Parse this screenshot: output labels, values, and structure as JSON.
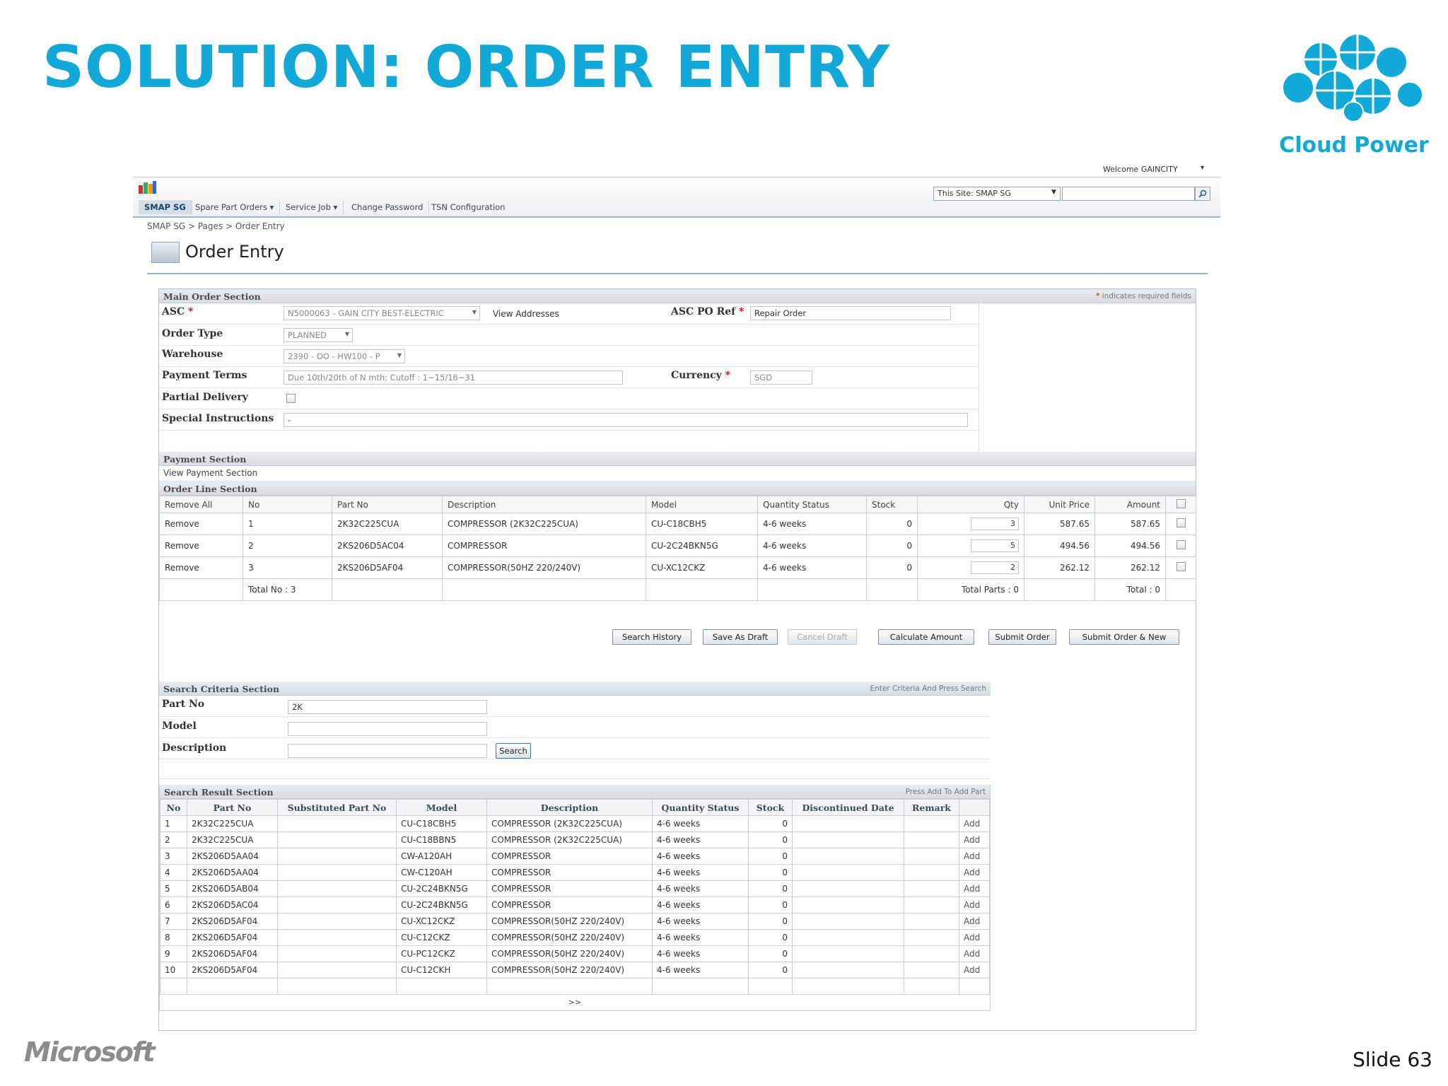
{
  "slide": {
    "title": "SOLUTION: ORDER ENTRY",
    "logo_text": "Cloud Power",
    "footer_brand": "Microsoft",
    "slide_number": "Slide 63",
    "accent_color": "#12a8d8"
  },
  "header": {
    "welcome": "Welcome GAINCITY",
    "site_select": "This Site: SMAP SG",
    "nav_tabs": [
      {
        "label": "SMAP SG",
        "active": true
      },
      {
        "label": "Spare Part Orders ▾"
      },
      {
        "label": "Service Job ▾"
      },
      {
        "label": "Change Password"
      },
      {
        "label": "TSN Configuration"
      }
    ]
  },
  "breadcrumb": "SMAP SG > Pages > Order Entry",
  "page_title": "Order Entry",
  "main_section": {
    "title": "Main Order Section",
    "required_note": "indicates required fields",
    "asc_label": "ASC",
    "asc_value": "N5000063 - GAIN CITY BEST-ELECTRIC",
    "view_addresses": "View Addresses",
    "asc_po_label": "ASC PO Ref",
    "asc_po_value": "Repair Order",
    "order_type_label": "Order Type",
    "order_type_value": "PLANNED",
    "warehouse_label": "Warehouse",
    "warehouse_value": "2390 - OO - HW100 - P",
    "payment_terms_label": "Payment Terms",
    "payment_terms_value": "Due 10th/20th of N mth; Cutoff : 1~15/16~31",
    "currency_label": "Currency",
    "currency_value": "SGD",
    "partial_delivery_label": "Partial Delivery",
    "special_instructions_label": "Special Instructions",
    "special_instructions_value": "-"
  },
  "payment_section": {
    "title": "Payment Section",
    "link": "View Payment Section"
  },
  "order_lines": {
    "title": "Order Line Section",
    "headers": [
      "Remove All",
      "No",
      "Part No",
      "Description",
      "Model",
      "Quantity Status",
      "Stock",
      "Qty",
      "Unit Price",
      "Amount"
    ],
    "rows": [
      {
        "action": "Remove",
        "no": "1",
        "part_no": "2K32C225CUA",
        "description": "COMPRESSOR (2K32C225CUA)",
        "model": "CU-C18CBH5",
        "qty_status": "4-6 weeks",
        "stock": "0",
        "qty": "3",
        "unit_price": "587.65",
        "amount": "587.65"
      },
      {
        "action": "Remove",
        "no": "2",
        "part_no": "2KS206D5AC04",
        "description": "COMPRESSOR",
        "model": "CU-2C24BKN5G",
        "qty_status": "4-6 weeks",
        "stock": "0",
        "qty": "5",
        "unit_price": "494.56",
        "amount": "494.56"
      },
      {
        "action": "Remove",
        "no": "3",
        "part_no": "2KS206D5AF04",
        "description": "COMPRESSOR(50HZ 220/240V)",
        "model": "CU-XC12CKZ",
        "qty_status": "4-6 weeks",
        "stock": "0",
        "qty": "2",
        "unit_price": "262.12",
        "amount": "262.12"
      }
    ],
    "total_no": "Total No :  3",
    "total_parts": "Total Parts  :  0",
    "total": "Total :  0"
  },
  "buttons": {
    "search_history": "Search History",
    "save_draft": "Save As Draft",
    "cancel_draft": "Cancel Draft",
    "calculate": "Calculate Amount",
    "submit": "Submit Order",
    "submit_new": "Submit Order & New"
  },
  "search_criteria": {
    "title": "Search Criteria Section",
    "hint": "Enter Criteria And Press Search",
    "part_no_label": "Part No",
    "part_no_value": "2K",
    "model_label": "Model",
    "description_label": "Description",
    "search_button": "Search"
  },
  "search_results": {
    "title": "Search Result Section",
    "hint": "Press Add To Add Part",
    "headers": [
      "No",
      "Part No",
      "Substituted Part No",
      "Model",
      "Description",
      "Quantity Status",
      "Stock",
      "Discontinued Date",
      "Remark",
      ""
    ],
    "rows": [
      {
        "no": "1",
        "part_no": "2K32C225CUA",
        "model": "CU-C18CBH5",
        "description": "COMPRESSOR (2K32C225CUA)",
        "qty_status": "4-6 weeks",
        "stock": "0",
        "action": "Add"
      },
      {
        "no": "2",
        "part_no": "2K32C225CUA",
        "model": "CU-C18BBN5",
        "description": "COMPRESSOR (2K32C225CUA)",
        "qty_status": "4-6 weeks",
        "stock": "0",
        "action": "Add"
      },
      {
        "no": "3",
        "part_no": "2KS206D5AA04",
        "model": "CW-A120AH",
        "description": "COMPRESSOR",
        "qty_status": "4-6 weeks",
        "stock": "0",
        "action": "Add"
      },
      {
        "no": "4",
        "part_no": "2KS206D5AA04",
        "model": "CW-C120AH",
        "description": "COMPRESSOR",
        "qty_status": "4-6 weeks",
        "stock": "0",
        "action": "Add"
      },
      {
        "no": "5",
        "part_no": "2KS206D5AB04",
        "model": "CU-2C24BKN5G",
        "description": "COMPRESSOR",
        "qty_status": "4-6 weeks",
        "stock": "0",
        "action": "Add"
      },
      {
        "no": "6",
        "part_no": "2KS206D5AC04",
        "model": "CU-2C24BKN5G",
        "description": "COMPRESSOR",
        "qty_status": "4-6 weeks",
        "stock": "0",
        "action": "Add"
      },
      {
        "no": "7",
        "part_no": "2KS206D5AF04",
        "model": "CU-XC12CKZ",
        "description": "COMPRESSOR(50HZ 220/240V)",
        "qty_status": "4-6 weeks",
        "stock": "0",
        "action": "Add"
      },
      {
        "no": "8",
        "part_no": "2KS206D5AF04",
        "model": "CU-C12CKZ",
        "description": "COMPRESSOR(50HZ 220/240V)",
        "qty_status": "4-6 weeks",
        "stock": "0",
        "action": "Add"
      },
      {
        "no": "9",
        "part_no": "2KS206D5AF04",
        "model": "CU-PC12CKZ",
        "description": "COMPRESSOR(50HZ 220/240V)",
        "qty_status": "4-6 weeks",
        "stock": "0",
        "action": "Add"
      },
      {
        "no": "10",
        "part_no": "2KS206D5AF04",
        "model": "CU-C12CKH",
        "description": "COMPRESSOR(50HZ 220/240V)",
        "qty_status": "4-6 weeks",
        "stock": "0",
        "action": "Add"
      }
    ],
    "pager": ">>"
  }
}
